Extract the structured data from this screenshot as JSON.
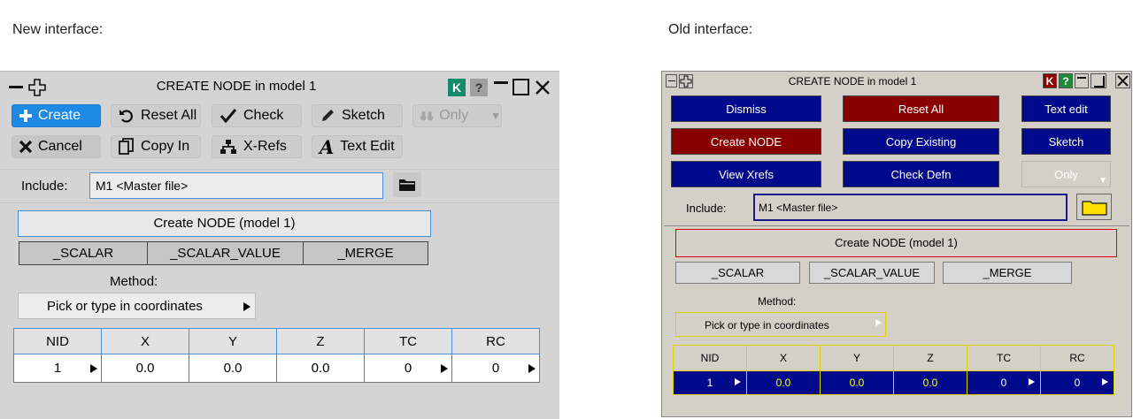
{
  "captions": {
    "new": "New interface:",
    "old": "Old interface:"
  },
  "new_ui": {
    "title": "CREATE NODE in model 1",
    "title_buttons": {
      "k": "K",
      "help": "?"
    },
    "toolbar": {
      "create": "Create",
      "reset_all": "Reset All",
      "check": "Check",
      "sketch": "Sketch",
      "only": "Only",
      "cancel": "Cancel",
      "copy_in": "Copy In",
      "xrefs": "X-Refs",
      "text_edit": "Text Edit"
    },
    "include": {
      "label": "Include:",
      "value": "M1  <Master file>"
    },
    "header": "Create NODE (model 1)",
    "options": [
      "_SCALAR",
      "_SCALAR_VALUE",
      "_MERGE"
    ],
    "method": {
      "label": "Method:",
      "value": "Pick or type in coordinates"
    },
    "grid": {
      "columns": [
        "NID",
        "X",
        "Y",
        "Z",
        "TC",
        "RC"
      ],
      "row": [
        "1",
        "0.0",
        "0.0",
        "0.0",
        "0",
        "0"
      ]
    }
  },
  "old_ui": {
    "title": "CREATE NODE in model 1",
    "title_buttons": {
      "k": "K",
      "help": "?"
    },
    "buttons": {
      "dismiss": "Dismiss",
      "reset_all": "Reset All",
      "text_edit": "Text edit",
      "create_node": "Create NODE",
      "copy_existing": "Copy Existing",
      "sketch": "Sketch",
      "view_xrefs": "View Xrefs",
      "check_defn": "Check Defn",
      "only": "Only"
    },
    "include": {
      "label": "Include:",
      "value": "M1  <Master file>"
    },
    "header": "Create NODE (model 1)",
    "options": [
      "_SCALAR",
      "_SCALAR_VALUE",
      "_MERGE"
    ],
    "method": {
      "label": "Method:",
      "value": "Pick or type in coordinates"
    },
    "grid": {
      "columns": [
        "NID",
        "X",
        "Y",
        "Z",
        "TC",
        "RC"
      ],
      "row": [
        "1",
        "0.0",
        "0.0",
        "0.0",
        "0",
        "0"
      ]
    }
  }
}
